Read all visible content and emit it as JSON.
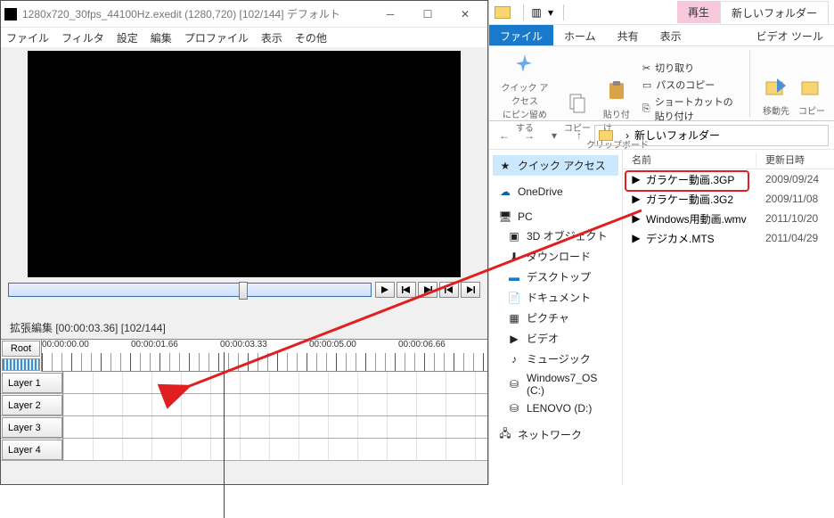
{
  "editor": {
    "title": "1280x720_30fps_44100Hz.exedit (1280,720)  [102/144]  デフォルト",
    "menu": [
      "ファイル",
      "フィルタ",
      "設定",
      "編集",
      "プロファイル",
      "表示",
      "その他"
    ],
    "timeline_title": "拡張編集 [00:00:03.36] [102/144]",
    "root_label": "Root",
    "time_labels": [
      "00:00:00.00",
      "00:00:01.66",
      "00:00:03.33",
      "00:00:05.00",
      "00:00:06.66"
    ],
    "layers": [
      "Layer 1",
      "Layer 2",
      "Layer 3",
      "Layer 4"
    ]
  },
  "explorer": {
    "tabs": {
      "file": "ファイル",
      "home": "ホーム",
      "share": "共有",
      "view": "表示",
      "play": "再生",
      "videotools": "ビデオ ツール",
      "newfolder": "新しいフォルダー"
    },
    "ribbon": {
      "pin": "クイック アクセス\nにピン留めする",
      "copy": "コピー",
      "paste": "貼り付け",
      "cut": "切り取り",
      "copypath": "パスのコピー",
      "pasteshortcut": "ショートカットの貼り付け",
      "clipboard": "クリップボード",
      "moveto": "移動先",
      "copyto": "コピー"
    },
    "address": {
      "label": "新しいフォルダー",
      "sep": "›"
    },
    "nav": {
      "quick": "クイック アクセス",
      "onedrive": "OneDrive",
      "pc": "PC",
      "items": [
        "3D オブジェクト",
        "ダウンロード",
        "デスクトップ",
        "ドキュメント",
        "ピクチャ",
        "ビデオ",
        "ミュージック",
        "Windows7_OS (C:)",
        "LENOVO (D:)"
      ],
      "network": "ネットワーク"
    },
    "columns": {
      "name": "名前",
      "date": "更新日時"
    },
    "files": [
      {
        "name": "ガラケー動画.3GP",
        "date": "2009/09/24"
      },
      {
        "name": "ガラケー動画.3G2",
        "date": "2009/11/08"
      },
      {
        "name": "Windows用動画.wmv",
        "date": "2011/10/20"
      },
      {
        "name": "デジカメ.MTS",
        "date": "2011/04/29"
      }
    ]
  }
}
